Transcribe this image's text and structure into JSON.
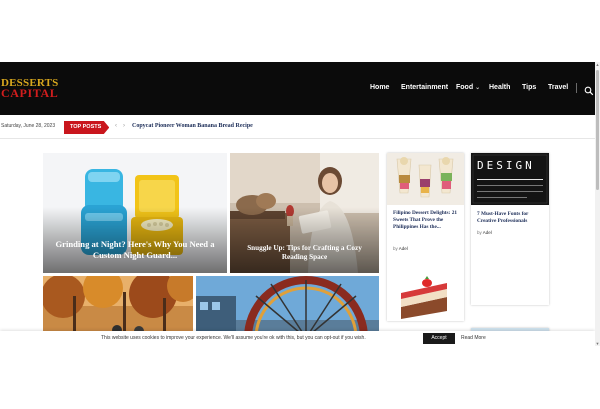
{
  "logo": {
    "line1": "DESSERTS",
    "line2": "CAPITAL"
  },
  "nav": {
    "items": [
      {
        "label": "Home"
      },
      {
        "label": "Entertainment"
      },
      {
        "label": "Food"
      },
      {
        "label": "Health"
      },
      {
        "label": "Tips"
      },
      {
        "label": "Travel"
      }
    ],
    "food_chevron": "⌄",
    "search_icon": "search-icon"
  },
  "ticker": {
    "date": "Saturday, June 28, 2023",
    "badge": "TOP POSTS",
    "prev": "‹",
    "next": "›",
    "headline": "Copycat Pioneer Woman Banana Bread Recipe"
  },
  "featured": [
    {
      "title": "Grinding at Night? Here's Why You Need a Custom Night Guard..."
    },
    {
      "title": "Snuggle Up: Tips for Crafting a Cozy Reading Space"
    }
  ],
  "side_posts": [
    {
      "title": "Filipino Dessert Delights: 21 Sweets That Prove the Philippines Has the...",
      "author_prefix": "by",
      "author": "Adel"
    },
    {
      "title": "7 Must-Have Fonts for Creative Professionals",
      "author_prefix": "by",
      "author": "Adel",
      "thumb_text": "DESIGN"
    }
  ],
  "cookie": {
    "text": "This website uses cookies to improve your experience. We'll assume you're ok with this, but you can opt-out if you wish.",
    "accept": "Accept",
    "read_more": "Read More"
  },
  "colors": {
    "header_bg": "#0b0b0b",
    "logo_gold": "#d9a81e",
    "logo_red": "#d11d1d",
    "badge_red": "#c9161d",
    "link_navy": "#1b2c57"
  }
}
